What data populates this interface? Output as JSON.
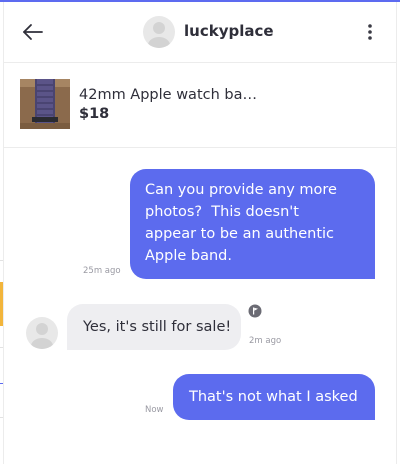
{
  "header": {
    "username": "luckyplace",
    "back_icon": "arrow-left-icon",
    "more_icon": "vertical-dots-icon"
  },
  "listing": {
    "title": "42mm Apple watch ba…",
    "price": "$18"
  },
  "messages": [
    {
      "direction": "outgoing",
      "lines": [
        "Can you provide any more",
        "photos?  This doesn't",
        "appear to be an authentic",
        "Apple band."
      ],
      "time": "25m ago"
    },
    {
      "direction": "incoming",
      "text": "Yes, it's still for sale!",
      "time": "2m ago"
    },
    {
      "direction": "outgoing",
      "text": "That's not what I asked",
      "time": "Now"
    }
  ],
  "colors": {
    "accent": "#5c6bee",
    "incoming_bubble": "#eeeef1",
    "text": "#2f2f3a",
    "muted": "#9a9aa3"
  }
}
